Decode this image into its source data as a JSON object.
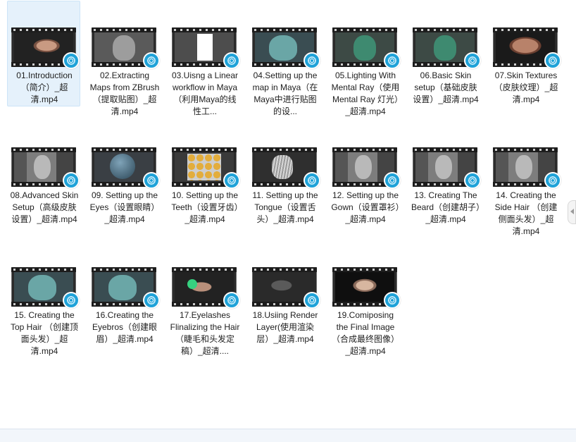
{
  "colors": {
    "selection_bg": "#e5f1fb",
    "selection_border": "#cce4f7",
    "media_icon": "#1fa2d8",
    "text": "#1e1e1e"
  },
  "files": [
    {
      "label": "01.Introduction（简介）_超清.mp4",
      "thumb": "face",
      "selected": true
    },
    {
      "label": "02.Extracting Maps from ZBrush （提取贴图）_超清.mp4",
      "thumb": "grey"
    },
    {
      "label": "03.Uisng a Linear workflow in Maya （利用Maya的线性工...",
      "thumb": "white"
    },
    {
      "label": "04.Setting up the map in Maya（在Maya中进行贴图的设...",
      "thumb": "teal"
    },
    {
      "label": "05.Lighting With Mental Ray（使用Mental Ray 灯光）_超清.mp4",
      "thumb": "green"
    },
    {
      "label": "06.Basic Skin setup（基础皮肤设置）_超清.mp4",
      "thumb": "green"
    },
    {
      "label": "07.Skin Textures（皮肤纹理）_超清.mp4",
      "thumb": "face-big"
    },
    {
      "label": "08.Advanced Skin Setup（高级皮肤设置）_超清.mp4",
      "thumb": "head-ui"
    },
    {
      "label": "09. Setting up the Eyes（设置眼睛）_超清.mp4",
      "thumb": "sphere"
    },
    {
      "label": "10. Setting up the Teeth（设置牙齿）_超清.mp4",
      "thumb": "teeth"
    },
    {
      "label": "11. Setting up the Tongue（设置舌头）_超清.mp4",
      "thumb": "tongue"
    },
    {
      "label": "12. Setting up the Gown（设置罩衫）_超清.mp4",
      "thumb": "head-ui"
    },
    {
      "label": "13. Creating The Beard（创建胡子）_超清.mp4",
      "thumb": "head-ui"
    },
    {
      "label": "14. Creating the Side Hair （创建侧面头发）_超清.mp4",
      "thumb": "head-ui"
    },
    {
      "label": "15. Creating the Top Hair （创建顶面头发）_超清.mp4",
      "thumb": "teal"
    },
    {
      "label": "16.Creating the Eyebros（创建眼眉）_超清.mp4",
      "thumb": "teal"
    },
    {
      "label": "17.Eyelashes Flinalizing the Hair（睫毛和头发定稿）_超清....",
      "thumb": "green-hair"
    },
    {
      "label": "18.Usiing Render Layer(使用渲染层）_超清.mp4",
      "thumb": "dark-head"
    },
    {
      "label": "19.Comiposing the Final Image（合成最终图像）_超清.mp4",
      "thumb": "render"
    }
  ]
}
